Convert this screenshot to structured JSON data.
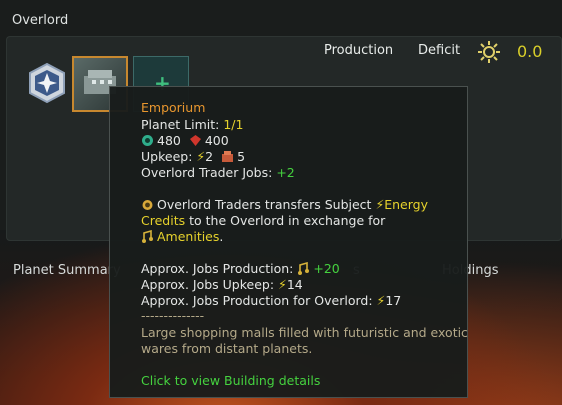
{
  "window": {
    "title": "Overlord"
  },
  "header": {
    "production_label": "Production",
    "deficit_label": "Deficit",
    "deficit_value": "0.0",
    "deficit_icon": "sun-icon"
  },
  "tabs": {
    "planet_summary": "Planet Summary",
    "holdings": "Holdings",
    "hidden_partial": "s"
  },
  "tooltip": {
    "name": "Emporium",
    "planet_limit_label": "Planet Limit:",
    "planet_limit_value": "1/1",
    "cost_alloys": "480",
    "cost_crystals": "400",
    "upkeep_label": "Upkeep:",
    "upkeep_energy": "2",
    "upkeep_goods": "5",
    "trader_jobs_label": "Overlord Trader Jobs:",
    "trader_jobs_value": "+2",
    "desc1_pre": "Overlord Traders transfers Subject",
    "desc1_energy": "Energy",
    "desc2_credits": "Credits",
    "desc2_post": "to the Overlord in exchange for",
    "desc3_amenities": "Amenities",
    "desc3_post": ".",
    "jobs_production_label": "Approx. Jobs Production:",
    "jobs_production_value": "+20",
    "jobs_upkeep_label": "Approx. Jobs Upkeep:",
    "jobs_upkeep_value": "14",
    "jobs_overlord_label": "Approx. Jobs Production for Overlord:",
    "jobs_overlord_value": "17",
    "separator": "--------------",
    "flavor1": "Large shopping malls filled with futuristic and exotic",
    "flavor2": "wares from distant planets.",
    "click_hint": "Click to view Building details"
  },
  "colors": {
    "accent_orange": "#e8962e",
    "energy_yellow": "#e6d22c",
    "positive_green": "#45d23f"
  }
}
